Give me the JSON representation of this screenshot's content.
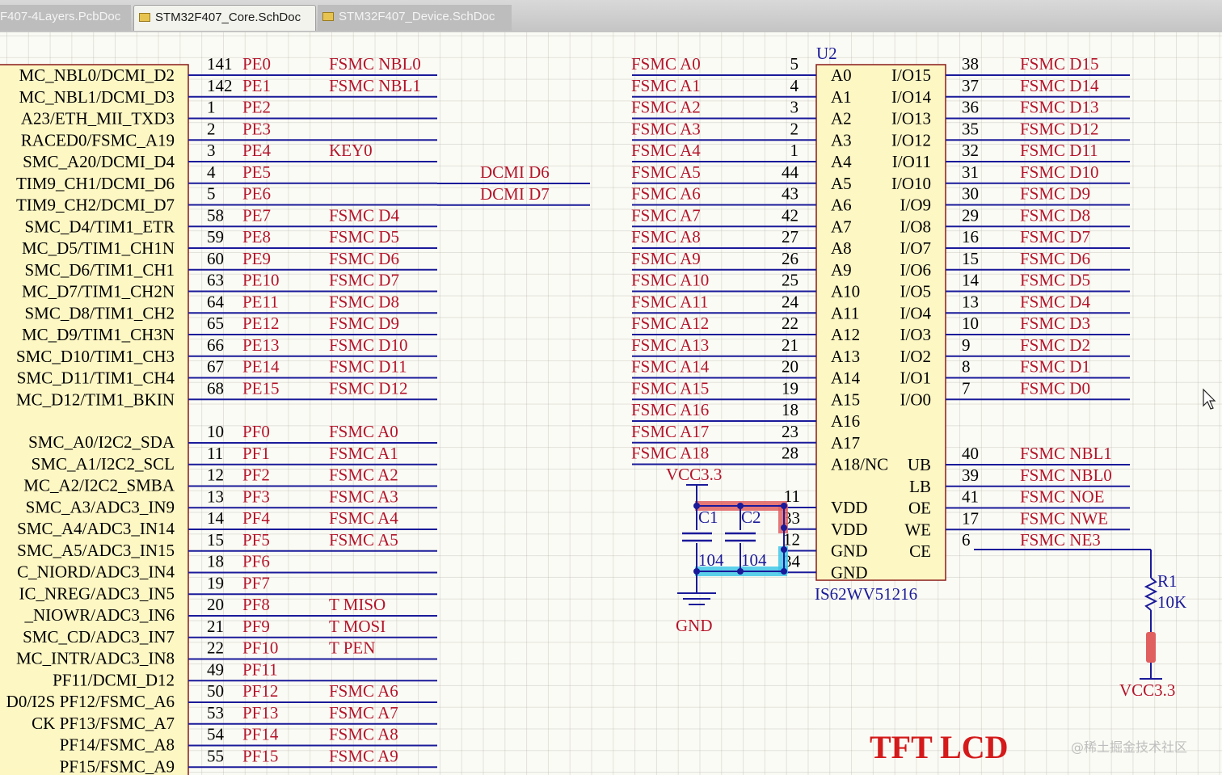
{
  "tabs": [
    {
      "label": "F407-4Layers.PcbDoc",
      "active": false
    },
    {
      "label": "STM32F407_Core.SchDoc",
      "active": true
    },
    {
      "label": "STM32F407_Device.SchDoc",
      "active": false
    }
  ],
  "mcu_pin_names": [
    "MC_NBL0/DCMI_D2",
    "MC_NBL1/DCMI_D3",
    "A23/ETH_MII_TXD3",
    "RACED0/FSMC_A19",
    "SMC_A20/DCMI_D4",
    "TIM9_CH1/DCMI_D6",
    "TIM9_CH2/DCMI_D7",
    "SMC_D4/TIM1_ETR",
    "MC_D5/TIM1_CH1N",
    "SMC_D6/TIM1_CH1",
    "MC_D7/TIM1_CH2N",
    "SMC_D8/TIM1_CH2",
    "MC_D9/TIM1_CH3N",
    "SMC_D10/TIM1_CH3",
    "SMC_D11/TIM1_CH4",
    "MC_D12/TIM1_BKIN",
    "SMC_A0/I2C2_SDA",
    "SMC_A1/I2C2_SCL",
    "MC_A2/I2C2_SMBA",
    "SMC_A3/ADC3_IN9",
    "SMC_A4/ADC3_IN14",
    "SMC_A5/ADC3_IN15",
    "C_NIORD/ADC3_IN4",
    "IC_NREG/ADC3_IN5",
    "_NIOWR/ADC3_IN6",
    "SMC_CD/ADC3_IN7",
    "MC_INTR/ADC3_IN8",
    "PF11/DCMI_D12",
    "D0/I2S PF12/FSMC_A6",
    "CK  PF13/FSMC_A7",
    "PF14/FSMC_A8",
    "PF15/FSMC_A9"
  ],
  "port_e": [
    {
      "num": "141",
      "pin": "PE0",
      "net": "FSMC_NBL0"
    },
    {
      "num": "142",
      "pin": "PE1",
      "net": "FSMC_NBL1"
    },
    {
      "num": "1",
      "pin": "PE2",
      "net": ""
    },
    {
      "num": "2",
      "pin": "PE3",
      "net": ""
    },
    {
      "num": "3",
      "pin": "PE4",
      "net": "KEY0"
    },
    {
      "num": "4",
      "pin": "PE5",
      "net": ""
    },
    {
      "num": "5",
      "pin": "PE6",
      "net": ""
    },
    {
      "num": "58",
      "pin": "PE7",
      "net": "FSMC_D4"
    },
    {
      "num": "59",
      "pin": "PE8",
      "net": "FSMC_D5"
    },
    {
      "num": "60",
      "pin": "PE9",
      "net": "FSMC_D6"
    },
    {
      "num": "63",
      "pin": "PE10",
      "net": "FSMC_D7"
    },
    {
      "num": "64",
      "pin": "PE11",
      "net": "FSMC_D8"
    },
    {
      "num": "65",
      "pin": "PE12",
      "net": "FSMC_D9"
    },
    {
      "num": "66",
      "pin": "PE13",
      "net": "FSMC_D10"
    },
    {
      "num": "67",
      "pin": "PE14",
      "net": "FSMC_D11"
    },
    {
      "num": "68",
      "pin": "PE15",
      "net": "FSMC_D12"
    }
  ],
  "port_f": [
    {
      "num": "10",
      "pin": "PF0",
      "net": "FSMC_A0"
    },
    {
      "num": "11",
      "pin": "PF1",
      "net": "FSMC_A1"
    },
    {
      "num": "12",
      "pin": "PF2",
      "net": "FSMC_A2"
    },
    {
      "num": "13",
      "pin": "PF3",
      "net": "FSMC_A3"
    },
    {
      "num": "14",
      "pin": "PF4",
      "net": "FSMC_A4"
    },
    {
      "num": "15",
      "pin": "PF5",
      "net": "FSMC_A5"
    },
    {
      "num": "18",
      "pin": "PF6",
      "net": ""
    },
    {
      "num": "19",
      "pin": "PF7",
      "net": ""
    },
    {
      "num": "20",
      "pin": "PF8",
      "net": "T_MISO"
    },
    {
      "num": "21",
      "pin": "PF9",
      "net": "T_MOSI"
    },
    {
      "num": "22",
      "pin": "PF10",
      "net": "T_PEN"
    },
    {
      "num": "49",
      "pin": "PF11",
      "net": ""
    },
    {
      "num": "50",
      "pin": "PF12",
      "net": "FSMC_A6"
    },
    {
      "num": "53",
      "pin": "PF13",
      "net": "FSMC_A7"
    },
    {
      "num": "54",
      "pin": "PF14",
      "net": "FSMC_A8"
    },
    {
      "num": "55",
      "pin": "PF15",
      "net": "FSMC_A9"
    }
  ],
  "dcmi_labels": [
    "DCMI_D6",
    "DCMI_D7"
  ],
  "u2": {
    "designator": "U2",
    "part": "IS62WV51216",
    "left_pins": [
      {
        "net": "FSMC_A0",
        "num": "5",
        "name": "A0"
      },
      {
        "net": "FSMC_A1",
        "num": "4",
        "name": "A1"
      },
      {
        "net": "FSMC_A2",
        "num": "3",
        "name": "A2"
      },
      {
        "net": "FSMC_A3",
        "num": "2",
        "name": "A3"
      },
      {
        "net": "FSMC_A4",
        "num": "1",
        "name": "A4"
      },
      {
        "net": "FSMC_A5",
        "num": "44",
        "name": "A5"
      },
      {
        "net": "FSMC_A6",
        "num": "43",
        "name": "A6"
      },
      {
        "net": "FSMC_A7",
        "num": "42",
        "name": "A7"
      },
      {
        "net": "FSMC_A8",
        "num": "27",
        "name": "A8"
      },
      {
        "net": "FSMC_A9",
        "num": "26",
        "name": "A9"
      },
      {
        "net": "FSMC_A10",
        "num": "25",
        "name": "A10"
      },
      {
        "net": "FSMC_A11",
        "num": "24",
        "name": "A11"
      },
      {
        "net": "FSMC_A12",
        "num": "22",
        "name": "A12"
      },
      {
        "net": "FSMC_A13",
        "num": "21",
        "name": "A13"
      },
      {
        "net": "FSMC_A14",
        "num": "20",
        "name": "A14"
      },
      {
        "net": "FSMC_A15",
        "num": "19",
        "name": "A15"
      },
      {
        "net": "FSMC_A16",
        "num": "18",
        "name": "A16"
      },
      {
        "net": "FSMC_A17",
        "num": "23",
        "name": "A17"
      },
      {
        "net": "FSMC_A18",
        "num": "28",
        "name": "A18/NC"
      }
    ],
    "power_pins": [
      {
        "num": "11",
        "name": "VDD"
      },
      {
        "num": "33",
        "name": "VDD"
      },
      {
        "num": "12",
        "name": "GND"
      },
      {
        "num": "34",
        "name": "GND"
      }
    ],
    "right_pins": [
      {
        "name": "I/O15",
        "num": "38",
        "net": "FSMC_D15"
      },
      {
        "name": "I/O14",
        "num": "37",
        "net": "FSMC_D14"
      },
      {
        "name": "I/O13",
        "num": "36",
        "net": "FSMC_D13"
      },
      {
        "name": "I/O12",
        "num": "35",
        "net": "FSMC_D12"
      },
      {
        "name": "I/O11",
        "num": "32",
        "net": "FSMC_D11"
      },
      {
        "name": "I/O10",
        "num": "31",
        "net": "FSMC_D10"
      },
      {
        "name": "I/O9",
        "num": "30",
        "net": "FSMC_D9"
      },
      {
        "name": "I/O8",
        "num": "29",
        "net": "FSMC_D8"
      },
      {
        "name": "I/O7",
        "num": "16",
        "net": "FSMC_D7"
      },
      {
        "name": "I/O6",
        "num": "15",
        "net": "FSMC_D6"
      },
      {
        "name": "I/O5",
        "num": "14",
        "net": "FSMC_D5"
      },
      {
        "name": "I/O4",
        "num": "13",
        "net": "FSMC_D4"
      },
      {
        "name": "I/O3",
        "num": "10",
        "net": "FSMC_D3"
      },
      {
        "name": "I/O2",
        "num": "9",
        "net": "FSMC_D2"
      },
      {
        "name": "I/O1",
        "num": "8",
        "net": "FSMC_D1"
      },
      {
        "name": "I/O0",
        "num": "7",
        "net": "FSMC_D0"
      }
    ],
    "control_pins": [
      {
        "name": "UB",
        "num": "40",
        "net": "FSMC_NBL1"
      },
      {
        "name": "LB",
        "num": "39",
        "net": "FSMC_NBL0"
      },
      {
        "name": "OE",
        "num": "41",
        "net": "FSMC_NOE"
      },
      {
        "name": "WE",
        "num": "17",
        "net": "FSMC_NWE"
      },
      {
        "name": "CE",
        "num": "6",
        "net": "FSMC_NE3"
      }
    ]
  },
  "caps": {
    "c1": "C1",
    "c2": "C2",
    "c1_val": "104",
    "c2_val": "104",
    "vcc": "VCC3.3",
    "gnd": "GND"
  },
  "resistor": {
    "des": "R1",
    "val": "10K",
    "vcc": "VCC3.3"
  },
  "sheet_title": "TFT LCD",
  "watermark": "@稀土掘金技术社区",
  "colors": {
    "net": "#b4142a",
    "wire": "#1a1a9a",
    "title": "#d41a1a",
    "highlight_red": "#e06060",
    "highlight_cyan": "#40c8e8"
  }
}
